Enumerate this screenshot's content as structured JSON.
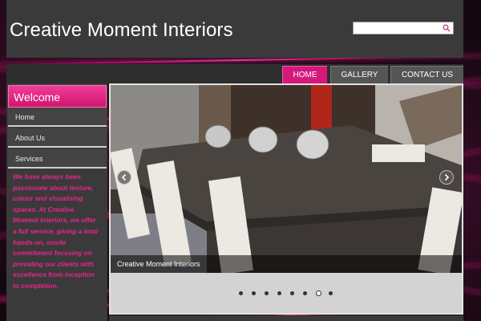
{
  "site": {
    "title": "Creative Moment Interiors"
  },
  "search": {
    "value": "",
    "placeholder": "",
    "icon": "search-icon"
  },
  "nav": {
    "items": [
      {
        "label": "HOME",
        "active": true
      },
      {
        "label": "GALLERY",
        "active": false
      },
      {
        "label": "CONTACT US",
        "active": false
      }
    ]
  },
  "sidebar": {
    "heading": "Welcome",
    "links": [
      {
        "label": "Home"
      },
      {
        "label": "About Us"
      },
      {
        "label": "Services"
      }
    ],
    "intro": "We have always been passionate about texture, colour and visualising spaces. At Creative Moment Interiors, we offer a full service, giving a total hands-on, onsite commitment focusing on providing our clients with excellence from inception to completion."
  },
  "slideshow": {
    "caption": "Creative Moment Interiors",
    "total_slides": 8,
    "active_slide": 7,
    "prev_icon": "chevron-left-icon",
    "next_icon": "chevron-right-icon"
  },
  "colors": {
    "accent": "#d5197b",
    "header_bg": "#3a3a3a",
    "sidebar_text": "#e8258c"
  }
}
